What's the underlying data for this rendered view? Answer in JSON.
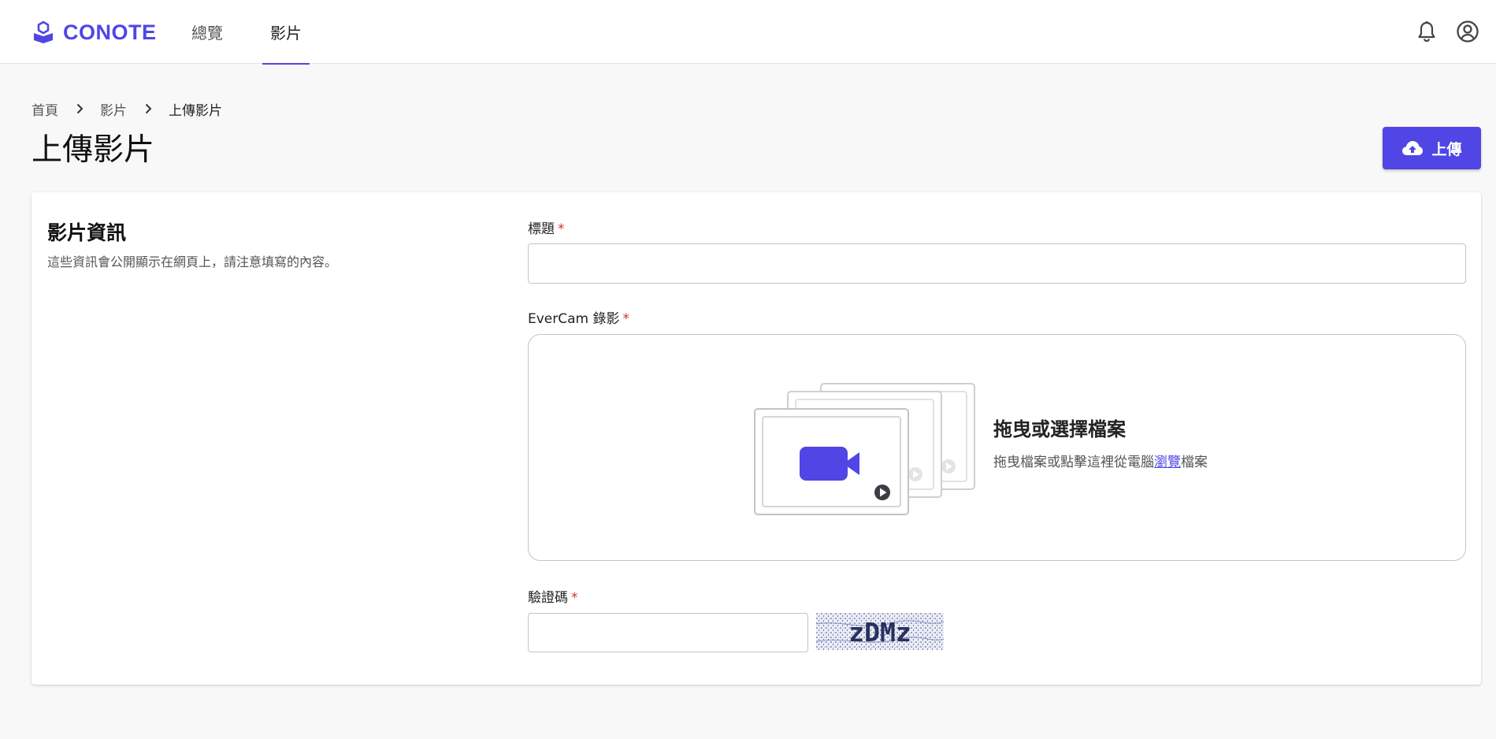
{
  "header": {
    "logo_text": "CONOTE",
    "tabs": [
      {
        "label": "總覽",
        "active": false
      },
      {
        "label": "影片",
        "active": true
      }
    ],
    "icons": [
      "bell-icon",
      "account-circle-icon"
    ]
  },
  "breadcrumb": {
    "items": [
      "首頁",
      "影片",
      "上傳影片"
    ]
  },
  "page": {
    "title": "上傳影片",
    "upload_button_label": "上傳"
  },
  "form": {
    "section_title": "影片資訊",
    "section_description": "這些資訊會公開顯示在網頁上，請注意填寫的內容。",
    "title_label": "標題",
    "title_value": "",
    "recording_label": "EverCam 錄影",
    "dropzone": {
      "title": "拖曳或選擇檔案",
      "sub_before": "拖曳檔案或點擊這裡從電腦",
      "link_text": "瀏覽",
      "sub_after": "檔案"
    },
    "captcha_label": "驗證碼",
    "captcha_value": "",
    "captcha_text": "zDMz",
    "required_mark": "*"
  },
  "colors": {
    "accent": "#4f46e5",
    "required": "#d32f2f",
    "background": "#f8f8f8"
  }
}
